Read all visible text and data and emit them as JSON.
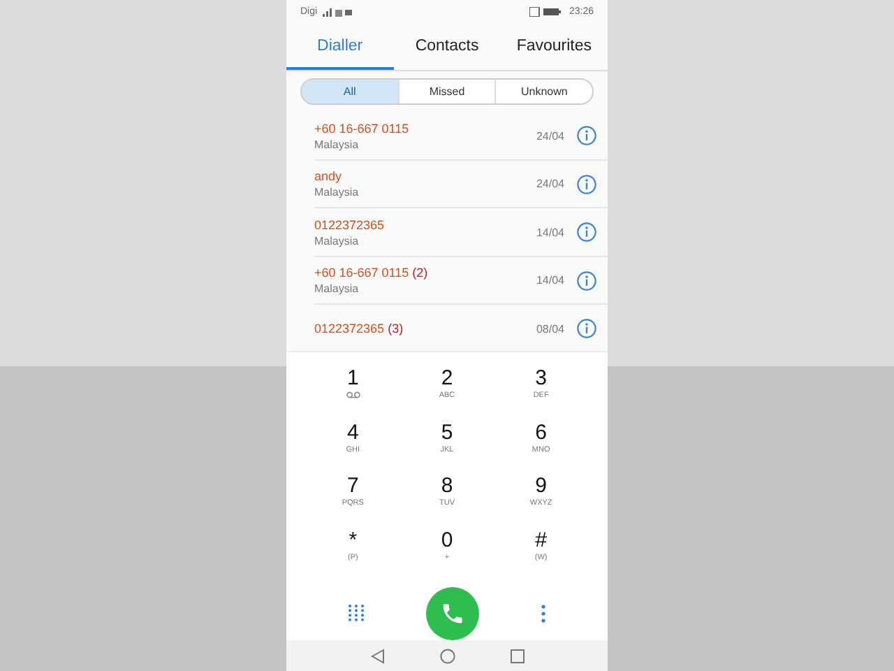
{
  "status_bar": {
    "carrier": "Digi",
    "time": "23:26"
  },
  "tabs": [
    {
      "label": "Dialler",
      "selected": true
    },
    {
      "label": "Contacts",
      "selected": false
    },
    {
      "label": "Favourites",
      "selected": false
    }
  ],
  "filters": [
    {
      "label": "All",
      "selected": true
    },
    {
      "label": "Missed",
      "selected": false
    },
    {
      "label": "Unknown",
      "selected": false
    }
  ],
  "calls": [
    {
      "name": "+60 16-667 0115",
      "location": "Malaysia",
      "date": "24/04"
    },
    {
      "name": "andy",
      "location": "Malaysia",
      "date": "24/04"
    },
    {
      "name": "0122372365",
      "location": "Malaysia",
      "date": "14/04"
    },
    {
      "name": "+60 16-667 0115",
      "count": "(2)",
      "location": "Malaysia",
      "date": "14/04"
    },
    {
      "name": "0122372365",
      "count": "(3)",
      "date": "08/04"
    }
  ],
  "keys": [
    {
      "digit": "1",
      "kind": "voicemail"
    },
    {
      "digit": "2",
      "letters": "ABC",
      "kind": "letters"
    },
    {
      "digit": "3",
      "letters": "DEF",
      "kind": "letters"
    },
    {
      "digit": "4",
      "letters": "GHI",
      "kind": "letters"
    },
    {
      "digit": "5",
      "letters": "JKL",
      "kind": "letters"
    },
    {
      "digit": "6",
      "letters": "MNO",
      "kind": "letters"
    },
    {
      "digit": "7",
      "letters": "PQRS",
      "kind": "letters"
    },
    {
      "digit": "8",
      "letters": "TUV",
      "kind": "letters"
    },
    {
      "digit": "9",
      "letters": "WXYZ",
      "kind": "letters"
    },
    {
      "digit": "*",
      "letters": "(P)",
      "kind": "letters"
    },
    {
      "digit": "0",
      "letters": "+",
      "kind": "letters"
    },
    {
      "digit": "#",
      "letters": "(W)",
      "kind": "letters"
    }
  ]
}
